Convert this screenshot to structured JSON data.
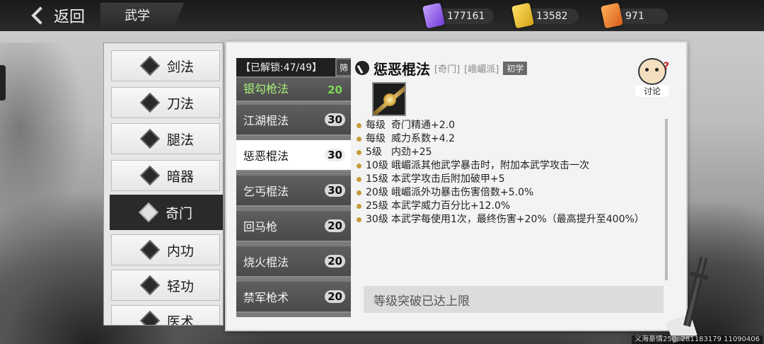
{
  "header": {
    "back_label": "返回",
    "title": "武学",
    "currencies": [
      {
        "icon": "purple-ticket-icon",
        "value": "177161"
      },
      {
        "icon": "gold-ticket-icon",
        "value": "13582"
      },
      {
        "icon": "orange-ticket-icon",
        "value": "971"
      }
    ]
  },
  "categories": [
    {
      "label": "剑法",
      "icon": "sword-icon",
      "active": false
    },
    {
      "label": "刀法",
      "icon": "blade-icon",
      "active": false
    },
    {
      "label": "腿法",
      "icon": "kick-icon",
      "active": false
    },
    {
      "label": "暗器",
      "icon": "shuriken-icon",
      "active": false
    },
    {
      "label": "奇门",
      "icon": "staff-icon",
      "active": true
    },
    {
      "label": "内功",
      "icon": "meditation-icon",
      "active": false
    },
    {
      "label": "轻功",
      "icon": "swift-icon",
      "active": false
    },
    {
      "label": "医术",
      "icon": "medicine-icon",
      "active": false
    }
  ],
  "skill_list": {
    "unlock_label": "【已解锁:47/49】",
    "filter_label": "筛",
    "items": [
      {
        "name": "银勾枪法",
        "level": "20"
      },
      {
        "name": "江湖棍法",
        "level": "30"
      },
      {
        "name": "惩恶棍法",
        "level": "30",
        "active": true
      },
      {
        "name": "乞丐棍法",
        "level": "30"
      },
      {
        "name": "回马枪",
        "level": "20"
      },
      {
        "name": "烧火棍法",
        "level": "20"
      },
      {
        "name": "禁军枪术",
        "level": "20"
      }
    ]
  },
  "detail": {
    "title": "惩恶棍法",
    "tag_type": "[奇门]",
    "tag_sect": "[峨嵋派]",
    "rank": "初学",
    "discuss_label": "讨论",
    "effects": [
      {
        "level": "每级",
        "text": "奇门精通+2.0"
      },
      {
        "level": "每级",
        "text": "威力系数+4.2"
      },
      {
        "level": "5级",
        "text": "内劲+25"
      },
      {
        "level": "10级",
        "text": "峨嵋派其他武学暴击时，附加本武学攻击一次"
      },
      {
        "level": "15级",
        "text": "本武学攻击后附加破甲+5"
      },
      {
        "level": "20级",
        "text": "峨嵋派外功暴击伤害倍数+5.0%"
      },
      {
        "level": "25级",
        "text": "本武学威力百分比+12.0%"
      },
      {
        "level": "30级",
        "text": "本武学每使用1次，最终伤害+20%（最高提升至400%）"
      }
    ],
    "break_status": "等级突破已达上限"
  },
  "footer": {
    "id_text": "义海豪情250: 281183179  11090406"
  }
}
